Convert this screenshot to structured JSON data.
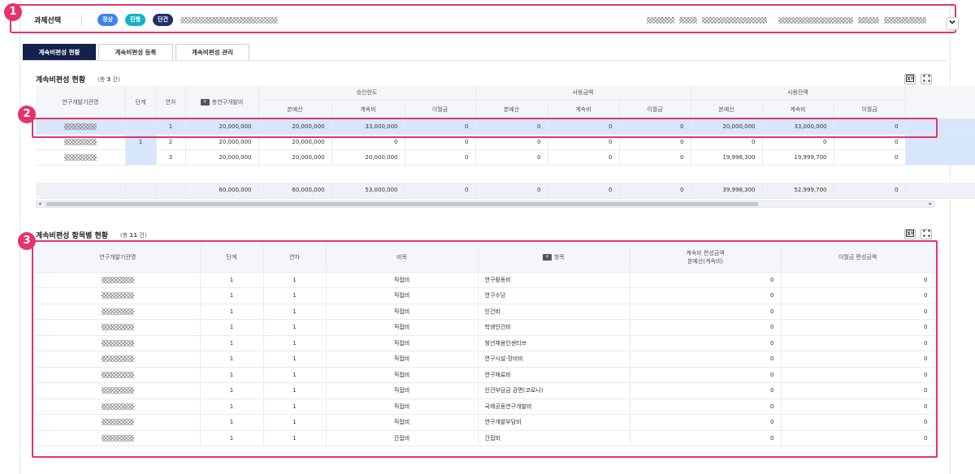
{
  "header": {
    "title": "과제선택",
    "badges": [
      "정상",
      "진행",
      "단건"
    ],
    "chevron": "chevron-down-icon"
  },
  "markers": [
    "1",
    "2",
    "3"
  ],
  "tabs": [
    "계속비편성 현황",
    "계속비편성 등록",
    "계속비편성 관리"
  ],
  "section1": {
    "title": "계속비편성 현황",
    "count_prefix": "(총",
    "count": "3",
    "count_suffix": "건)",
    "headers": {
      "org": "연구개발기관명",
      "stage": "단계",
      "year": "연차",
      "total": "총연구개발비",
      "approved": "승인한도",
      "used": "사용금액",
      "used2": "사용잔액",
      "sub_main": "본예산",
      "sub_cont": "계속비",
      "sub_carry": "이월금"
    },
    "rows": [
      {
        "stage": "",
        "year": "1",
        "total": "20,000,000",
        "a1": "20,000,000",
        "a2": "33,000,000",
        "a3": "0",
        "u1": "0",
        "u2": "0",
        "u3": "0",
        "r1": "20,000,000",
        "r2": "33,000,000",
        "r3": "0"
      },
      {
        "stage": "1",
        "year": "2",
        "total": "20,000,000",
        "a1": "20,000,000",
        "a2": "0",
        "a3": "0",
        "u1": "0",
        "u2": "0",
        "u3": "0",
        "r1": "0",
        "r2": "0",
        "r3": "0"
      },
      {
        "stage": "",
        "year": "3",
        "total": "20,000,000",
        "a1": "20,000,000",
        "a2": "20,000,000",
        "a3": "0",
        "u1": "0",
        "u2": "0",
        "u3": "0",
        "r1": "19,998,300",
        "r2": "19,999,700",
        "r3": "0"
      }
    ],
    "sum": {
      "total": "60,000,000",
      "a1": "60,000,000",
      "a2": "53,000,000",
      "a3": "0",
      "u1": "0",
      "u2": "0",
      "u3": "0",
      "r1": "39,998,300",
      "r2": "52,999,700",
      "r3": "0"
    }
  },
  "section2": {
    "title": "계속비편성 항목별 현황",
    "count_prefix": "(총",
    "count": "11",
    "count_suffix": "건)",
    "headers": {
      "org": "연구개발기관명",
      "stage": "단계",
      "year": "연차",
      "cat": "비목",
      "item": "항목",
      "amount_l1": "계속비 편성금액",
      "amount_l2": "본예산(계속비)",
      "carry": "이월금 편성금액"
    },
    "rows": [
      {
        "stage": "1",
        "year": "1",
        "cat": "직접비",
        "item": "연구활동비",
        "amt": "0",
        "carry": "0"
      },
      {
        "stage": "1",
        "year": "1",
        "cat": "직접비",
        "item": "연구수당",
        "amt": "0",
        "carry": "0"
      },
      {
        "stage": "1",
        "year": "1",
        "cat": "직접비",
        "item": "인건비",
        "amt": "0",
        "carry": "0"
      },
      {
        "stage": "1",
        "year": "1",
        "cat": "직접비",
        "item": "학생인건비",
        "amt": "0",
        "carry": "0"
      },
      {
        "stage": "1",
        "year": "1",
        "cat": "직접비",
        "item": "청년채용인센티브",
        "amt": "0",
        "carry": "0"
      },
      {
        "stage": "1",
        "year": "1",
        "cat": "직접비",
        "item": "연구시설·장비비",
        "amt": "0",
        "carry": "0"
      },
      {
        "stage": "1",
        "year": "1",
        "cat": "직접비",
        "item": "연구재료비",
        "amt": "0",
        "carry": "0"
      },
      {
        "stage": "1",
        "year": "1",
        "cat": "직접비",
        "item": "인건부담금 감면(코로나)",
        "amt": "0",
        "carry": "0"
      },
      {
        "stage": "1",
        "year": "1",
        "cat": "직접비",
        "item": "국제공동연구개발비",
        "amt": "0",
        "carry": "0"
      },
      {
        "stage": "1",
        "year": "1",
        "cat": "직접비",
        "item": "연구개발부담비",
        "amt": "0",
        "carry": "0"
      },
      {
        "stage": "1",
        "year": "1",
        "cat": "간접비",
        "item": "간접비",
        "amt": "0",
        "carry": "0"
      }
    ]
  }
}
